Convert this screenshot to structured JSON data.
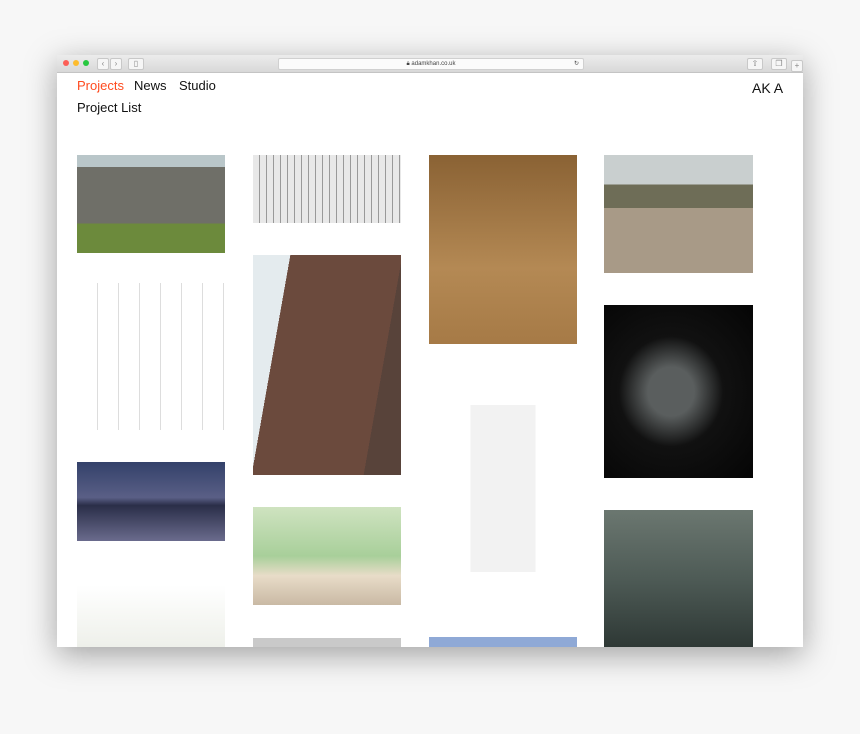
{
  "browser": {
    "url": "adamkhan.co.uk",
    "lock_icon": "lock-icon",
    "reload_icon": "reload-icon"
  },
  "nav": {
    "items": [
      {
        "label": "Projects",
        "active": true
      },
      {
        "label": "News"
      },
      {
        "label": "Studio"
      }
    ],
    "sub": "Project List",
    "logo": "AK A"
  },
  "colors": {
    "accent": "#ff4b1f",
    "text": "#111111"
  }
}
